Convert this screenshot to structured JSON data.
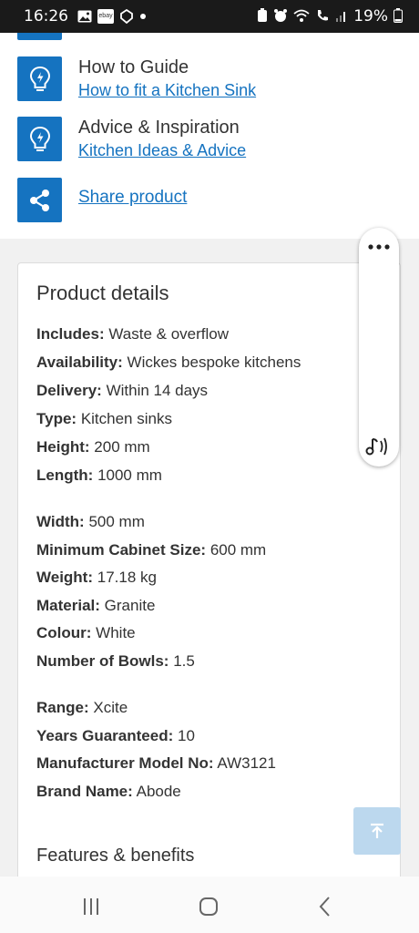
{
  "status_bar": {
    "time": "16:26",
    "ebay_label": "ebay",
    "battery": "19%"
  },
  "guides": [
    {
      "title": "How to Guide",
      "link": "How to fit a Kitchen Sink",
      "icon": "lightbulb-icon"
    },
    {
      "title": "Advice & Inspiration",
      "link": "Kitchen Ideas & Advice",
      "icon": "lightbulb-icon"
    }
  ],
  "share": {
    "label": "Share product",
    "icon": "share-icon"
  },
  "product_details": {
    "heading": "Product details",
    "specs": [
      {
        "label": "Includes:",
        "value": "Waste & overflow"
      },
      {
        "label": "Availability:",
        "value": "Wickes bespoke kitchens"
      },
      {
        "label": "Delivery:",
        "value": "Within 14 days"
      },
      {
        "label": "Type:",
        "value": "Kitchen sinks"
      },
      {
        "label": "Height:",
        "value": "200 mm"
      },
      {
        "label": "Length:",
        "value": "1000 mm"
      },
      {
        "label": "Width:",
        "value": "500 mm"
      },
      {
        "label": "Minimum Cabinet Size:",
        "value": "600 mm"
      },
      {
        "label": "Weight:",
        "value": "17.18 kg"
      },
      {
        "label": "Material:",
        "value": "Granite"
      },
      {
        "label": "Colour:",
        "value": "White"
      },
      {
        "label": "Number of Bowls:",
        "value": "1.5"
      },
      {
        "label": "Range:",
        "value": "Xcite"
      },
      {
        "label": "Years Guaranteed:",
        "value": "10"
      },
      {
        "label": "Manufacturer Model No:",
        "value": "AW3121"
      },
      {
        "label": "Brand Name:",
        "value": "Abode"
      }
    ]
  },
  "features": {
    "heading": "Features & benefits"
  },
  "colors": {
    "accent": "#1573c0",
    "text": "#333333",
    "scroll_top_bg": "#bcd8ee"
  }
}
